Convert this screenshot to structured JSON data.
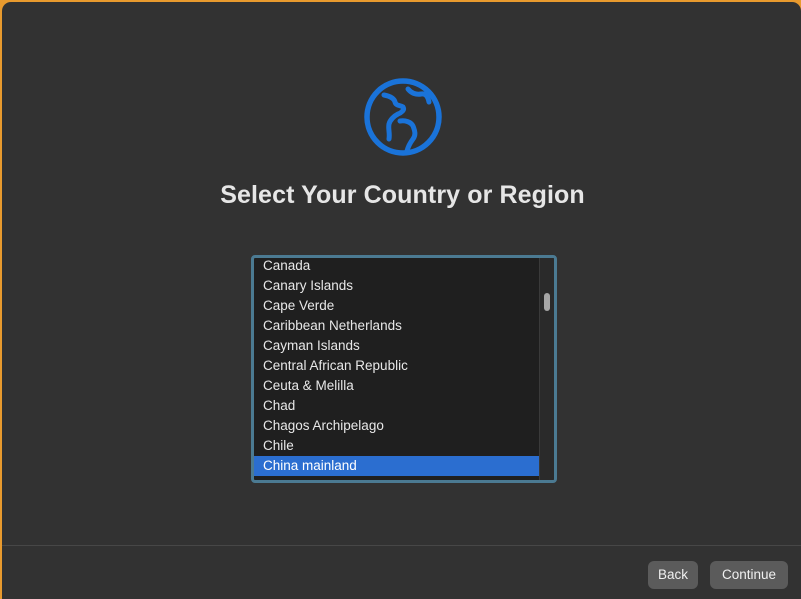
{
  "setup": {
    "title": "Select Your Country or Region",
    "icon": "globe-icon",
    "accent_color": "#1a73d9",
    "selected_color": "#2b6ed0"
  },
  "country_list": {
    "items": [
      "Canada",
      "Canary Islands",
      "Cape Verde",
      "Caribbean Netherlands",
      "Cayman Islands",
      "Central African Republic",
      "Ceuta & Melilla",
      "Chad",
      "Chagos Archipelago",
      "Chile",
      "China mainland"
    ],
    "selected": "China mainland"
  },
  "footer": {
    "back_label": "Back",
    "continue_label": "Continue"
  }
}
